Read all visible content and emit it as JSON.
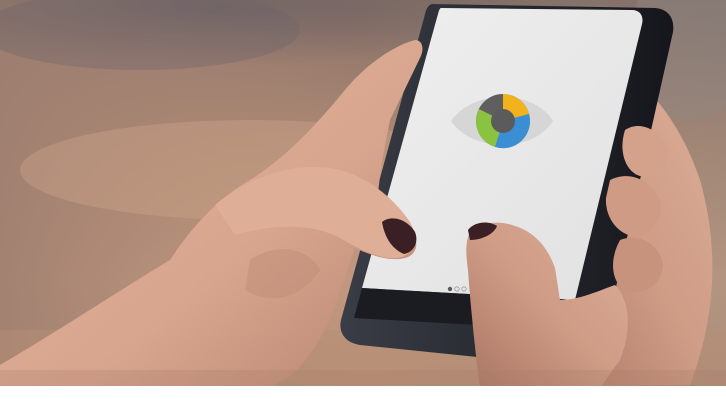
{
  "scene": {
    "colors": {
      "background_warm": "#b8917a",
      "table_wood": "#c39a7e",
      "skin_light": "#e2b49e",
      "skin_shadow": "#b37f6a",
      "nail_polish": "#3a1f24",
      "phone_body": "#23252c",
      "phone_screen": "#e9e9e9",
      "eye_white": "#d6d6d6",
      "iris_yellow": "#f2b21b",
      "iris_blue": "#3a8fd4",
      "iris_green": "#8bc23f",
      "iris_gray": "#8a8a8a",
      "pupil": "#5b5b5b"
    },
    "app_screen": {
      "logo_icon": "eye-logo-icon",
      "pager_dot_count": 3,
      "active_page": 1
    }
  }
}
